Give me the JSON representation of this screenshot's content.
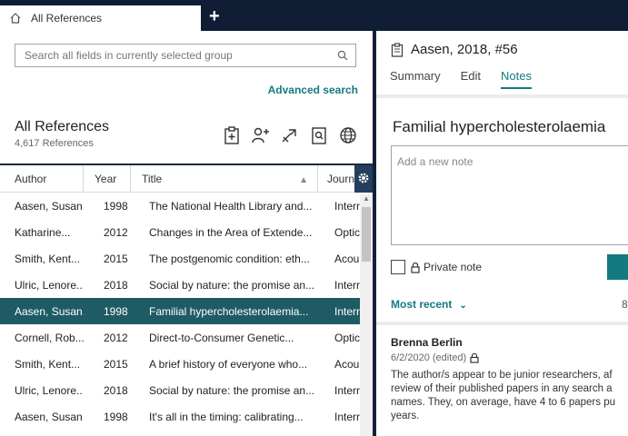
{
  "tab": {
    "label": "All References",
    "new_tab_label": "+"
  },
  "search": {
    "placeholder": "Search all fields in currently selected group"
  },
  "advanced_search": "Advanced search",
  "library": {
    "title": "All References",
    "count": "4,617 References"
  },
  "toolbar_icons": [
    "clipboard-icon",
    "add-person-icon",
    "share-icon",
    "find-pdf-icon",
    "globe-icon"
  ],
  "columns": {
    "author": "Author",
    "year": "Year",
    "title": "Title",
    "journal": "Journ"
  },
  "rows": [
    {
      "author": "Aasen, Susan...",
      "year": "1998",
      "title": "The National Health Library and...",
      "journal": "Interr"
    },
    {
      "author": "Katharine...",
      "year": "2012",
      "title": "Changes in the Area of Extende...",
      "journal": "Optic"
    },
    {
      "author": "Smith, Kent...",
      "year": "2015",
      "title": "The postgenomic condition: eth...",
      "journal": "Acou"
    },
    {
      "author": "Ulric, Lenore...",
      "year": "2018",
      "title": "Social by nature: the promise an...",
      "journal": "Interr"
    },
    {
      "author": "Aasen, Susan...",
      "year": "1998",
      "title": "Familial hypercholesterolaemia...",
      "journal": "Interr",
      "selected": true
    },
    {
      "author": "Cornell, Rob...",
      "year": "2012",
      "title": "Direct-to-Consumer Genetic...",
      "journal": "Optic"
    },
    {
      "author": "Smith, Kent...",
      "year": "2015",
      "title": "A brief history of everyone who...",
      "journal": "Acou"
    },
    {
      "author": "Ulric, Lenore...",
      "year": "2018",
      "title": "Social by nature: the promise an...",
      "journal": "Interr"
    },
    {
      "author": "Aasen, Susan...",
      "year": "1998",
      "title": "It's all in the timing: calibrating...",
      "journal": "Interr"
    }
  ],
  "detail": {
    "title": "Aasen, 2018, #56",
    "tabs": [
      "Summary",
      "Edit",
      "Notes"
    ],
    "active_tab": "Notes",
    "ref_title": "Familial hypercholesterolaemia",
    "note_placeholder": "Add a new note",
    "private_note": "Private note",
    "sort_label": "Most recent",
    "count_fragment": "8",
    "note": {
      "author": "Brenna Berlin",
      "date": "6/2/2020 (edited)",
      "text": "The author/s appear to be junior researchers, af\nreview of their published papers in any search a\nnames. They, on average, have 4 to 6 papers pu\nyears."
    }
  },
  "colors": {
    "accent": "#137a80",
    "selected_row": "#1e5b64",
    "topbar": "#0f1d35"
  }
}
